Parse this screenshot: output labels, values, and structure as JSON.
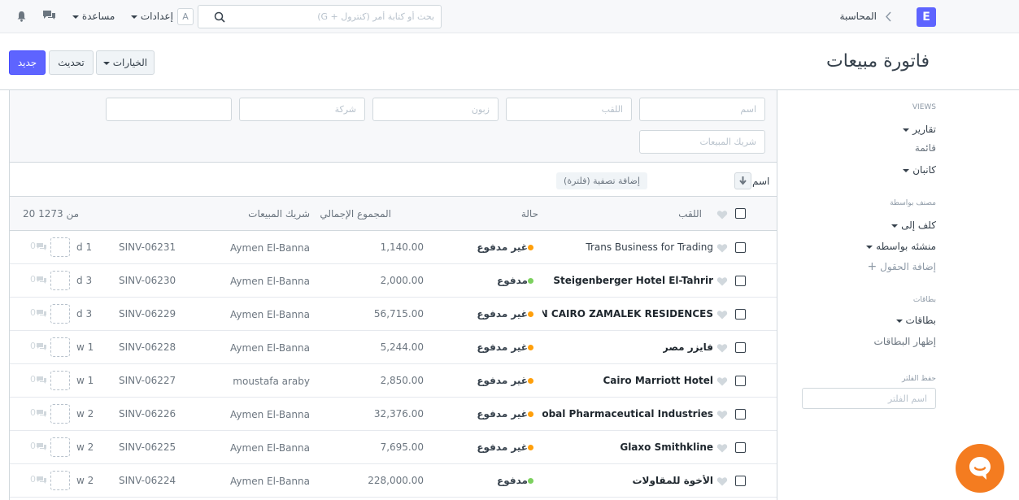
{
  "navbar": {
    "brand_letter": "E",
    "breadcrumb": "المحاسبة",
    "search_placeholder": "بحث أو كتابة أمر (كنترول + G)",
    "avatar_letter": "A",
    "settings_label": "إعدادات",
    "help_label": "مساعدة"
  },
  "page": {
    "title": "فاتورة مبيعات",
    "new_button": "جديد",
    "refresh_button": "تحديث",
    "options_button": "الخيارات"
  },
  "sidebar": {
    "views_label": "VIEWS",
    "views": [
      "تقارير",
      "قائمة",
      "كانبان"
    ],
    "assigned_label": "مصنف بواسطة",
    "assigned_items": [
      "كلف إلى",
      "منشئه بواسطه"
    ],
    "add_fields": "إضافة الحقول",
    "cards_label": "بطاقات",
    "cards_item": "بطاقات",
    "show_cards": "إظهار البطاقات",
    "save_filter_label": "حفظ الفلتر",
    "filter_name_placeholder": "اسم الفلتر"
  },
  "filters": {
    "name_placeholder": "اسم",
    "title_placeholder": "اللقب",
    "customer_placeholder": "زبون",
    "company_placeholder": "شركة",
    "sales_partner_placeholder": "شريك المبيعات",
    "sort_label": "اسم",
    "add_filter": "إضافة تصفية (فلترة)"
  },
  "list": {
    "columns": {
      "title": "اللقب",
      "status": "حالة",
      "grand_total": "المجموع الإجمالي",
      "sales_partner": "شريك المبيعات",
      "count": "20 من 1273"
    },
    "rows": [
      {
        "title": "Trans Business for Trading",
        "status": "غير مدفوع",
        "status_color": "#ff9f0a",
        "total": "1,140.00",
        "partner": "Aymen El-Banna",
        "id": "SINV-06231",
        "age": "1 d",
        "comments": "0",
        "bold": false
      },
      {
        "title": "Steigenberger Hotel El-Tahrir",
        "status": "مدفوع",
        "status_color": "#7cd05e",
        "total": "2,000.00",
        "partner": "Aymen El-Banna",
        "id": "SINV-06230",
        "age": "3 d",
        "comments": "0",
        "bold": true
      },
      {
        "title": "ILTON CAIRO ZAMALEK RESIDENCES",
        "status": "غير مدفوع",
        "status_color": "#ff9f0a",
        "total": "56,715.00",
        "partner": "Aymen El-Banna",
        "id": "SINV-06229",
        "age": "3 d",
        "comments": "0",
        "bold": true
      },
      {
        "title": "فايزر مصر",
        "status": "غير مدفوع",
        "status_color": "#ff9f0a",
        "total": "5,244.00",
        "partner": "Aymen El-Banna",
        "id": "SINV-06228",
        "age": "1 w",
        "comments": "0",
        "bold": true
      },
      {
        "title": "Cairo Marriott Hotel",
        "status": "غير مدفوع",
        "status_color": "#ff9f0a",
        "total": "2,850.00",
        "partner": "moustafa araby",
        "id": "SINV-06227",
        "age": "1 w",
        "comments": "0",
        "bold": true
      },
      {
        "title": "Global Pharmaceutical Industries",
        "status": "غير مدفوع",
        "status_color": "#ff9f0a",
        "total": "32,376.00",
        "partner": "Aymen El-Banna",
        "id": "SINV-06226",
        "age": "2 w",
        "comments": "0",
        "bold": true
      },
      {
        "title": "Glaxo Smithkline",
        "status": "غير مدفوع",
        "status_color": "#ff9f0a",
        "total": "7,695.00",
        "partner": "Aymen El-Banna",
        "id": "SINV-06225",
        "age": "2 w",
        "comments": "0",
        "bold": true
      },
      {
        "title": "الأخوة للمقاولات",
        "status": "مدفوع",
        "status_color": "#7cd05e",
        "total": "228,000.00",
        "partner": "Aymen El-Banna",
        "id": "SINV-06224",
        "age": "2 w",
        "comments": "0",
        "bold": true
      }
    ]
  },
  "colors": {
    "primary": "#5e64ff",
    "unpaid": "#ff9f0a",
    "paid": "#7cd05e",
    "chat": "#f47c20"
  }
}
